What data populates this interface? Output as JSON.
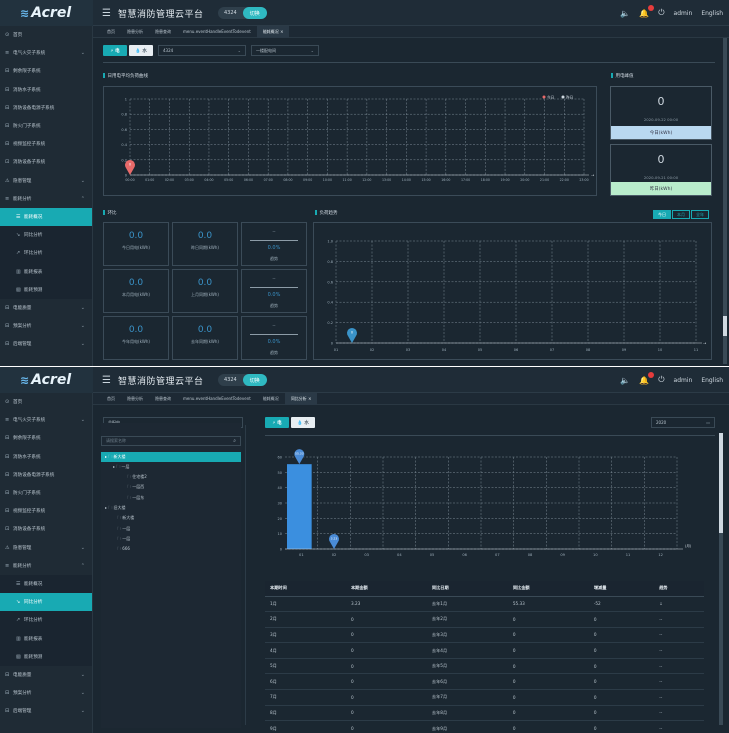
{
  "brand": "Acrel",
  "app_title": "智慧消防管理云平台",
  "header": {
    "project_id": "4324",
    "switch_label": "切换",
    "user": "admin",
    "language": "English"
  },
  "colors": {
    "accent": "#18aab3",
    "chart_blue": "#3a93c8",
    "alert_red": "#e63c3c"
  },
  "icons": [
    "menu-icon",
    "speaker-icon",
    "bell-icon",
    "power-icon",
    "search-icon",
    "folder-icon",
    "location-pin-icon"
  ],
  "sidebar1": [
    {
      "label": "首页",
      "icon": "⊙",
      "chev": ""
    },
    {
      "label": "电气火灾子系统",
      "icon": "≡",
      "chev": "⌄"
    },
    {
      "label": "剩余限子系统",
      "icon": "⊟",
      "chev": ""
    },
    {
      "label": "消防水子系统",
      "icon": "⊟",
      "chev": ""
    },
    {
      "label": "消防设备电源子系统",
      "icon": "⊟",
      "chev": ""
    },
    {
      "label": "防火门子系统",
      "icon": "⊟",
      "chev": ""
    },
    {
      "label": "视频监控子系统",
      "icon": "⊟",
      "chev": ""
    },
    {
      "label": "消防设备子系统",
      "icon": "⊡",
      "chev": ""
    },
    {
      "label": "隐患管理",
      "icon": "⚠",
      "chev": "⌄"
    },
    {
      "label": "能耗分析",
      "icon": "≡",
      "chev": "⌃"
    },
    {
      "label": "能耗概况",
      "icon": "☰",
      "chev": "",
      "sub": true,
      "active": true
    },
    {
      "label": "同比分析",
      "icon": "↘",
      "chev": "",
      "sub": true
    },
    {
      "label": "环比分析",
      "icon": "↗",
      "chev": "",
      "sub": true
    },
    {
      "label": "能耗报表",
      "icon": "▥",
      "chev": "",
      "sub": true
    },
    {
      "label": "能耗预测",
      "icon": "▧",
      "chev": "",
      "sub": true
    },
    {
      "label": "电能质量",
      "icon": "⊟",
      "chev": "⌄"
    },
    {
      "label": "预案分析",
      "icon": "⊟",
      "chev": "⌄"
    },
    {
      "label": "后端管理",
      "icon": "⊟",
      "chev": "⌄"
    }
  ],
  "sidebar2": [
    {
      "label": "首页",
      "icon": "⊙",
      "chev": ""
    },
    {
      "label": "电气火灾子系统",
      "icon": "≡",
      "chev": "⌄"
    },
    {
      "label": "剩余限子系统",
      "icon": "⊟",
      "chev": ""
    },
    {
      "label": "消防水子系统",
      "icon": "⊟",
      "chev": ""
    },
    {
      "label": "消防设备电源子系统",
      "icon": "⊟",
      "chev": ""
    },
    {
      "label": "防火门子系统",
      "icon": "⊟",
      "chev": ""
    },
    {
      "label": "视频监控子系统",
      "icon": "⊟",
      "chev": ""
    },
    {
      "label": "消防设备子系统",
      "icon": "⊡",
      "chev": ""
    },
    {
      "label": "隐患管理",
      "icon": "⚠",
      "chev": "⌄"
    },
    {
      "label": "能耗分析",
      "icon": "≡",
      "chev": "⌃"
    },
    {
      "label": "能耗概况",
      "icon": "☰",
      "chev": "",
      "sub": true
    },
    {
      "label": "同比分析",
      "icon": "↘",
      "chev": "",
      "sub": true,
      "active": true
    },
    {
      "label": "环比分析",
      "icon": "↗",
      "chev": "",
      "sub": true
    },
    {
      "label": "能耗报表",
      "icon": "▥",
      "chev": "",
      "sub": true
    },
    {
      "label": "能耗预测",
      "icon": "▧",
      "chev": "",
      "sub": true
    },
    {
      "label": "电能质量",
      "icon": "⊟",
      "chev": "⌄"
    },
    {
      "label": "预案分析",
      "icon": "⊟",
      "chev": "⌄"
    },
    {
      "label": "后端管理",
      "icon": "⊟",
      "chev": "⌄"
    }
  ],
  "tabs1": [
    {
      "label": "首页",
      "active": false
    },
    {
      "label": "隐患分析",
      "active": false
    },
    {
      "label": "隐患查询",
      "active": false
    },
    {
      "label": "menu.eventHandleEventTodevent",
      "active": false
    },
    {
      "label": "能耗概况  ×",
      "active": true
    }
  ],
  "tabs2": [
    {
      "label": "首页",
      "active": false
    },
    {
      "label": "隐患分析",
      "active": false
    },
    {
      "label": "隐患查询",
      "active": false
    },
    {
      "label": "menu.eventHandleEventTodevent",
      "active": false
    },
    {
      "label": "能耗概况",
      "active": false
    },
    {
      "label": "同比分析  ×",
      "active": true
    }
  ],
  "overview": {
    "btn_electric": "⚡ 电",
    "btn_water": "💧 水",
    "select_project": "4324",
    "select_meter": "一楼配电间",
    "daily_load_title": "日用电平均负荷曲线",
    "legend_today": "今日",
    "legend_yesterday": "昨日",
    "peak_title": "用电峰值",
    "peak_today_value": "0",
    "peak_today_time": "2020-09-22 00:00",
    "peak_today_label": "今日(kWh)",
    "peak_yesterday_value": "0",
    "peak_yesterday_time": "2020-09-21 00:00",
    "peak_yesterday_label": "昨日(kWh)",
    "ring_title": "环比",
    "trend_title": "负荷趋势",
    "trend_tabs": [
      "今日",
      "本月",
      "全年"
    ],
    "stats": [
      {
        "val": "0.0",
        "lab": "今日用电(kWh)"
      },
      {
        "val": "0.0",
        "lab": "昨日同期(kWh)"
      },
      {
        "val": "0.0",
        "lab": "本月用电(kWh)"
      },
      {
        "val": "0.0",
        "lab": "上月同期(kWh)"
      },
      {
        "val": "0.0",
        "lab": "今年用电(kWh)"
      },
      {
        "val": "0.0",
        "lab": "去年同期(kWh)"
      }
    ],
    "ratios": [
      {
        "top": "--",
        "val": "0.0%",
        "lab": "趋势"
      },
      {
        "top": "--",
        "val": "0.0%",
        "lab": "趋势"
      },
      {
        "top": "--",
        "val": "0.0%",
        "lab": "趋势"
      }
    ]
  },
  "yoy": {
    "tree_select": "总配电",
    "search_placeholder": "请搜索名称",
    "btn_electric": "⚡ 电",
    "btn_water": "💧 水",
    "year": "2020",
    "tree": [
      {
        "label": "▸ 🗀 新大楼",
        "indent": 0,
        "sel": true
      },
      {
        "label": "▸ 🗀 一层",
        "indent": 8
      },
      {
        "label": "🗀 住宅楼2",
        "indent": 22
      },
      {
        "label": "🗀 一层西",
        "indent": 22
      },
      {
        "label": "🗀 一层东",
        "indent": 22
      },
      {
        "label": "▸ 🗀 旧大楼",
        "indent": 0
      },
      {
        "label": "🗀 新大楼",
        "indent": 12
      },
      {
        "label": "🗀 一层",
        "indent": 12
      },
      {
        "label": "🗀 一层",
        "indent": 12
      },
      {
        "label": "🗀 666",
        "indent": 12
      }
    ],
    "table_headers": [
      "本期时间",
      "本期金额",
      "同比日期",
      "同比金额",
      "增减量",
      "趋势"
    ],
    "table_rows": [
      [
        "1月",
        "3.23",
        "去年1月",
        "55.33",
        "-52",
        "↓"
      ],
      [
        "2月",
        "0",
        "去年2月",
        "0",
        "0",
        "--"
      ],
      [
        "3月",
        "0",
        "去年3月",
        "0",
        "0",
        "--"
      ],
      [
        "4月",
        "0",
        "去年4月",
        "0",
        "0",
        "--"
      ],
      [
        "5月",
        "0",
        "去年5月",
        "0",
        "0",
        "--"
      ],
      [
        "6月",
        "0",
        "去年6月",
        "0",
        "0",
        "--"
      ],
      [
        "7月",
        "0",
        "去年7月",
        "0",
        "0",
        "--"
      ],
      [
        "8月",
        "0",
        "去年8月",
        "0",
        "0",
        "--"
      ],
      [
        "9月",
        "0",
        "去年9月",
        "0",
        "0",
        "--"
      ]
    ]
  },
  "chart_data": [
    {
      "type": "line",
      "name": "日用电平均负荷曲线",
      "x": [
        "00:00",
        "01:00",
        "02:00",
        "03:00",
        "04:00",
        "05:00",
        "06:00",
        "07:00",
        "08:00",
        "09:00",
        "10:00",
        "11:00",
        "12:00",
        "13:00",
        "14:00",
        "15:00",
        "16:00",
        "17:00",
        "18:00",
        "19:00",
        "20:00",
        "21:00",
        "22:00",
        "23:00"
      ],
      "series": [
        {
          "name": "今日",
          "values": [
            0
          ]
        },
        {
          "name": "昨日",
          "values": [
            0
          ]
        }
      ],
      "yticks": [
        "1",
        "0.8",
        "0.6",
        "0.4",
        "0.2",
        "0"
      ],
      "marker_label": "0",
      "legend": "top-right"
    },
    {
      "type": "line",
      "name": "负荷趋势",
      "x": [
        "01",
        "02",
        "03",
        "04",
        "05",
        "06",
        "07",
        "08",
        "09",
        "10",
        "11"
      ],
      "series": [
        {
          "name": "今日",
          "values": [
            0
          ]
        }
      ],
      "yticks": [
        "1.0",
        "0.8",
        "0.6",
        "0.4",
        "0.2",
        "0"
      ],
      "marker_label": "0"
    },
    {
      "type": "bar",
      "name": "同比分析",
      "categories": [
        "01",
        "02",
        "03",
        "04",
        "05",
        "06",
        "07",
        "08",
        "09",
        "10",
        "11",
        "12"
      ],
      "values": [
        55.33,
        0,
        0,
        0,
        0,
        0,
        0,
        0,
        0,
        0,
        0,
        0
      ],
      "yticks": [
        "60",
        "50",
        "40",
        "30",
        "20",
        "10",
        "0"
      ],
      "ylim": [
        0,
        60
      ],
      "bar_label": "55.33",
      "pin_label": "3.23",
      "unit": "(月)"
    }
  ]
}
